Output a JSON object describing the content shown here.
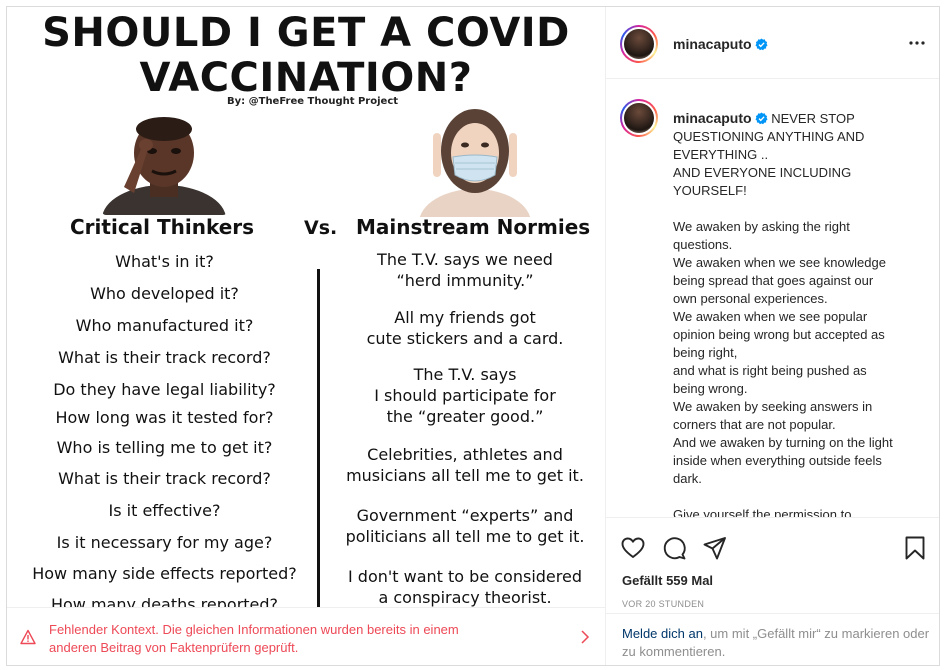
{
  "post_image": {
    "title_line1": "SHOULD I GET A COVID",
    "title_line2": "VACCINATION?",
    "byline": "By: @TheFree Thought Project",
    "left_heading": "Critical Thinkers",
    "vs": "Vs.",
    "right_heading": "Mainstream Normies",
    "questions": [
      "What's in it?",
      "Who developed it?",
      "Who manufactured it?",
      "What is their track record?",
      "Do they have legal liability?",
      "How long was it tested for?",
      "Who is telling me to get it?",
      "What is their track record?",
      "Is it effective?",
      "Is it necessary for my age?",
      "How many side effects reported?",
      "How many deaths reported?"
    ],
    "answers": [
      [
        "The T.V. says we need",
        "“herd immunity.”"
      ],
      [
        "All my friends got",
        "cute stickers and a card."
      ],
      [
        "The T.V. says",
        "I should participate for",
        "the “greater good.”"
      ],
      [
        "Celebrities, athletes and",
        "musicians all tell me to get it."
      ],
      [
        "Government “experts” and",
        "politicians all tell me to get it."
      ],
      [
        "I don't want to be considered",
        "a conspiracy theorist."
      ]
    ]
  },
  "fact_check": {
    "line1": "Fehlender Kontext. Die gleichen Informationen wurden bereits in einem",
    "line2": "anderen Beitrag von Faktenprüfern geprüft.",
    "icon": "warning-triangle-icon",
    "color": "#ed4956"
  },
  "header": {
    "username": "minacaputo",
    "verified_icon": "verified-badge-icon",
    "more_icon": "more-options-icon"
  },
  "caption": {
    "username": "minacaputo",
    "lines": [
      "NEVER STOP",
      "QUESTIONING ANYTHING AND",
      "EVERYTHING ..",
      "AND EVERYONE INCLUDING",
      "YOURSELF!",
      "",
      "We awaken by asking the right",
      "questions.",
      "We awaken when we see knowledge",
      "being spread that goes against our",
      "own personal experiences.",
      "We awaken when we see popular",
      "opinion being wrong but accepted as",
      "being right,",
      "and what is right being pushed as",
      "being wrong.",
      "We awaken by seeking answers in",
      "corners that are not popular.",
      "And we awaken by turning on the light",
      "inside when everything outside feels",
      "dark.",
      "",
      "Give yourself the permission to"
    ]
  },
  "actions": {
    "like_icon": "heart-icon",
    "comment_icon": "comment-icon",
    "share_icon": "share-icon",
    "save_icon": "bookmark-icon",
    "likes_text": "Gefällt 559 Mal",
    "timestamp": "VOR 20 STUNDEN"
  },
  "login_prompt": {
    "link_text": "Melde dich an",
    "rest_text": ", um mit „Gefällt mir“ zu markieren oder zu kommentieren."
  },
  "colors": {
    "accent_blue": "#0095f6",
    "link_dark_blue": "#00376b",
    "muted_gray": "#8e8e8e",
    "warning_red": "#ed4956"
  }
}
